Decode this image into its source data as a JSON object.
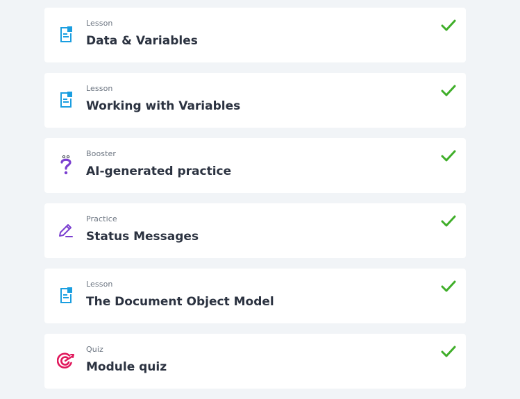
{
  "items": [
    {
      "kind": "Lesson",
      "title": "Data & Variables",
      "icon": "lesson-document-icon",
      "completed": true
    },
    {
      "kind": "Lesson",
      "title": "Working with Variables",
      "icon": "lesson-document-icon",
      "completed": true
    },
    {
      "kind": "Booster",
      "title": "AI-generated practice",
      "icon": "question-mark-icon",
      "completed": true
    },
    {
      "kind": "Practice",
      "title": "Status Messages",
      "icon": "pencil-icon",
      "completed": true
    },
    {
      "kind": "Lesson",
      "title": "The Document Object Model",
      "icon": "lesson-document-icon",
      "completed": true
    },
    {
      "kind": "Quiz",
      "title": "Module quiz",
      "icon": "target-icon",
      "completed": true
    }
  ],
  "colors": {
    "background": "#f1f4f7",
    "card": "#ffffff",
    "lesson_icon": "#1a9ee0",
    "booster_icon": "#7b3fd0",
    "practice_icon": "#7b3fd0",
    "quiz_icon": "#e0175b",
    "check": "#3fae29",
    "title_text": "#2b3240",
    "kind_text": "#6b7480"
  }
}
